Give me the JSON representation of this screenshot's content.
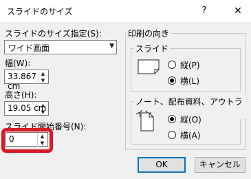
{
  "dialog": {
    "title": "スライドのサイズ",
    "help_glyph": "?",
    "close_glyph": "✕"
  },
  "size": {
    "label": "スライドのサイズ指定(S):",
    "value": "ワイド画面"
  },
  "width": {
    "label": "幅(W):",
    "value": "33.867 cm"
  },
  "height": {
    "label": "高さ(H):",
    "value": "19.05 cm"
  },
  "start": {
    "label": "スライド開始番号(N):",
    "value": "0"
  },
  "orientation": {
    "label": "印刷の向き",
    "slide": {
      "label": "スライド",
      "options": [
        {
          "label": "縦(P)",
          "selected": false
        },
        {
          "label": "横(L)",
          "selected": true
        }
      ]
    },
    "notes": {
      "label": "ノート、配布資料、アウトライン",
      "options": [
        {
          "label": "縦(O)",
          "selected": true
        },
        {
          "label": "横(A)",
          "selected": false
        }
      ]
    }
  },
  "buttons": {
    "ok": "OK",
    "cancel": "キャンセル"
  },
  "colors": {
    "highlight": "#e6141e",
    "accent": "#0078d7"
  }
}
